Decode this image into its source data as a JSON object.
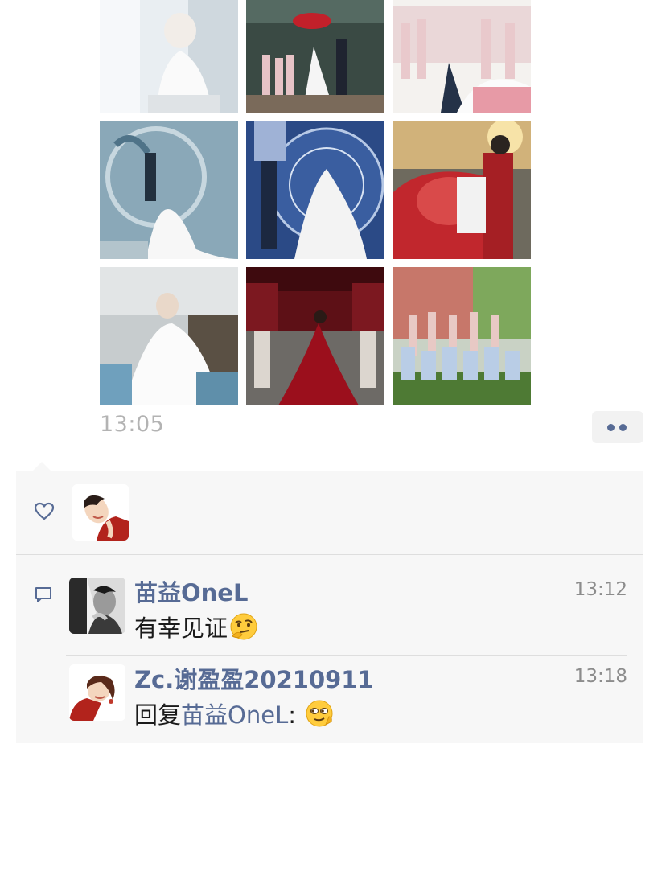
{
  "post": {
    "photos": [
      {
        "icon": "photo-bride-robe"
      },
      {
        "icon": "photo-bridal-party-umbrella"
      },
      {
        "icon": "photo-proposal-bridesmaids"
      },
      {
        "icon": "photo-couple-blue-stage"
      },
      {
        "icon": "photo-ring-exchange"
      },
      {
        "icon": "photo-red-car"
      },
      {
        "icon": "photo-bride-seated"
      },
      {
        "icon": "photo-red-gown"
      },
      {
        "icon": "photo-group-outdoor"
      }
    ],
    "time": "13:05",
    "more_icon": "more-dots-icon"
  },
  "likes": {
    "icon": "heart-icon"
  },
  "comments": [
    {
      "name": "苗益OneL",
      "time": "13:12",
      "text": "有幸见证",
      "emoji": "thinking-emoji"
    },
    {
      "name": "Zc.谢盈盈20210911",
      "time": "13:18",
      "reply_prefix": "回复",
      "reply_to": "苗益OneL",
      "reply_suffix": ": ",
      "emoji": "smirk-emoji"
    }
  ],
  "colors": {
    "link": "#576b95",
    "timestamp": "#b3b3b3",
    "panel_bg": "#f7f7f7"
  }
}
